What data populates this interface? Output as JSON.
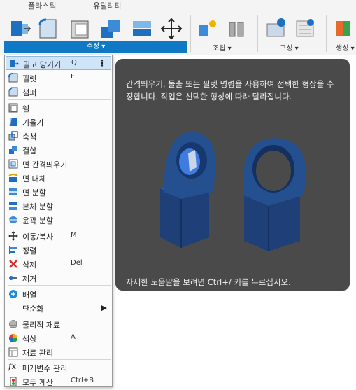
{
  "tabs": {
    "plastic": "플라스틱",
    "utility": "유틸리티"
  },
  "toolbar": {
    "modify_group_label": "수정 ▾",
    "assemble_label": "조립 ▾",
    "construct_label": "구성 ▾",
    "inspect_label": "생성 ▾"
  },
  "menu": {
    "items": [
      {
        "label": "밀고 당기기",
        "shortcut": "Q",
        "icon": "push-pull-icon"
      },
      {
        "label": "필렛",
        "shortcut": "F",
        "icon": "fillet-icon"
      },
      {
        "label": "챔퍼",
        "shortcut": "",
        "icon": "chamfer-icon"
      },
      {
        "label": "쉘",
        "shortcut": "",
        "icon": "shell-icon"
      },
      {
        "label": "기울기",
        "shortcut": "",
        "icon": "draft-icon"
      },
      {
        "label": "축척",
        "shortcut": "",
        "icon": "scale-icon"
      },
      {
        "label": "결합",
        "shortcut": "",
        "icon": "combine-icon"
      },
      {
        "label": "면 간격띄우기",
        "shortcut": "",
        "icon": "offset-face-icon"
      },
      {
        "label": "면 대체",
        "shortcut": "",
        "icon": "replace-face-icon"
      },
      {
        "label": "면 분할",
        "shortcut": "",
        "icon": "split-face-icon"
      },
      {
        "label": "본체 분할",
        "shortcut": "",
        "icon": "split-body-icon"
      },
      {
        "label": "윤곽 분할",
        "shortcut": "",
        "icon": "silhouette-split-icon"
      },
      {
        "label": "이동/복사",
        "shortcut": "M",
        "icon": "move-copy-icon"
      },
      {
        "label": "정렬",
        "shortcut": "",
        "icon": "align-icon"
      },
      {
        "label": "삭제",
        "shortcut": "Del",
        "icon": "delete-icon"
      },
      {
        "label": "제거",
        "shortcut": "",
        "icon": "remove-icon"
      },
      {
        "label": "배열",
        "shortcut": "",
        "icon": "pattern-icon"
      },
      {
        "label": "단순화",
        "shortcut": "",
        "icon": "simplify-icon"
      },
      {
        "label": "물리적 재료",
        "shortcut": "",
        "icon": "physical-material-icon"
      },
      {
        "label": "색상",
        "shortcut": "A",
        "icon": "appearance-icon"
      },
      {
        "label": "재료 관리",
        "shortcut": "",
        "icon": "manage-materials-icon"
      },
      {
        "label": "매개변수 관리",
        "shortcut": "",
        "icon": "fx-parameters-icon"
      },
      {
        "label": "모두 계산",
        "shortcut": "Ctrl+B",
        "icon": "compute-all-icon"
      }
    ]
  },
  "tooltip": {
    "description": "간격띄우기, 돌출 또는 필렛 명령을 사용하여 선택한 형상을 수정합니다. 작업은 선택한 형상에 따라 달라집니다.",
    "footer": "자세한 도움말을 보려면 Ctrl+/ 키를 누르십시오."
  },
  "colors": {
    "accent": "#0f79c5",
    "highlight": "#cfe4f7",
    "tooltip_bg": "#4a4a4a",
    "part_blue": "#1f4a8c"
  }
}
